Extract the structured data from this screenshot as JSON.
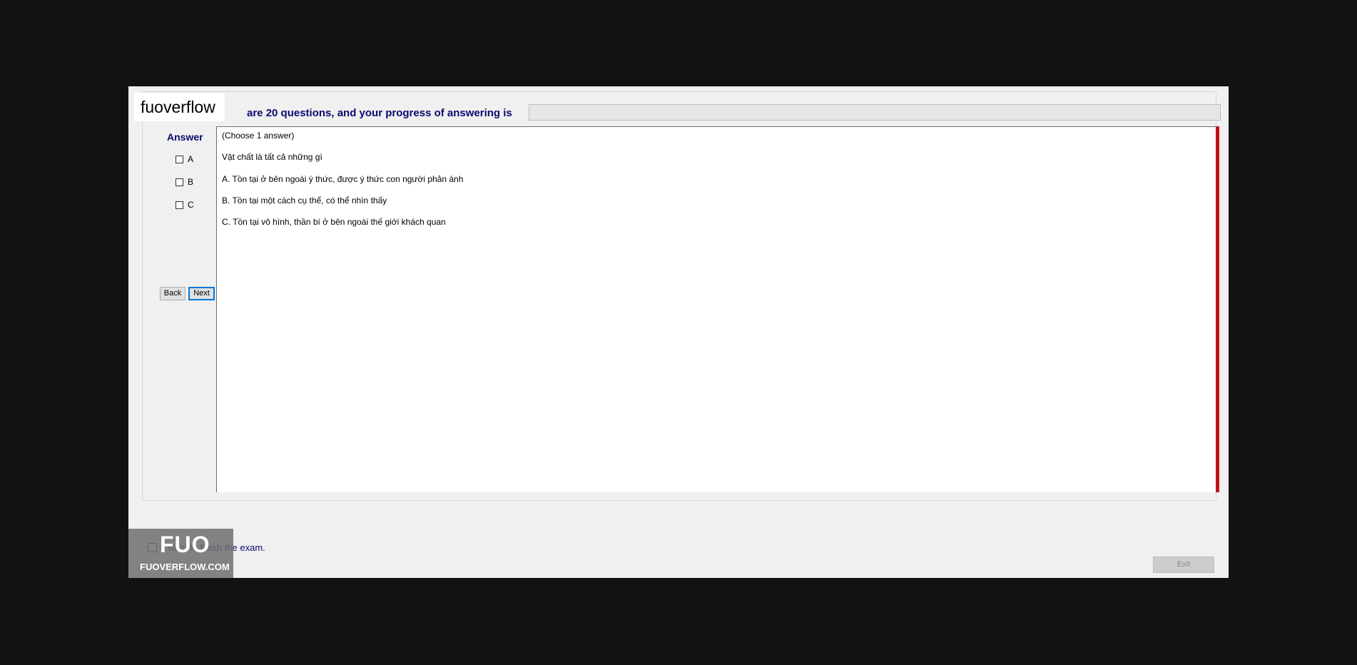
{
  "header": {
    "watermark_text": "fuoverflow",
    "progress_text": "are 20 questions, and your progress of answering is",
    "progress_fraction": 0
  },
  "answer_panel": {
    "title": "Answer",
    "options": [
      {
        "label": "A",
        "checked": false
      },
      {
        "label": "B",
        "checked": false
      },
      {
        "label": "C",
        "checked": false
      }
    ],
    "back_label": "Back",
    "next_label": "Next"
  },
  "question": {
    "instruction": "(Choose 1 answer)",
    "prompt": "Vật chất là tất cả những gì",
    "choices": [
      "A.  Tồn tại ở bên ngoài ý thức, được ý thức con người phản ánh",
      "B.  Tồn tại một cách cụ thể, có thể nhìn thấy",
      "C.  Tồn tại vô hình, thần bí ở bên ngoài thế giới khách quan"
    ]
  },
  "footer": {
    "finish_label": "I want to finish the exam.",
    "exit_label": "Exit",
    "logo_mark": "FUO",
    "logo_text": "FUOVERFLOW.COM"
  },
  "colors": {
    "accent_red": "#c1121c",
    "label_blue": "#0a0a6e",
    "focus_blue": "#0078d7"
  }
}
